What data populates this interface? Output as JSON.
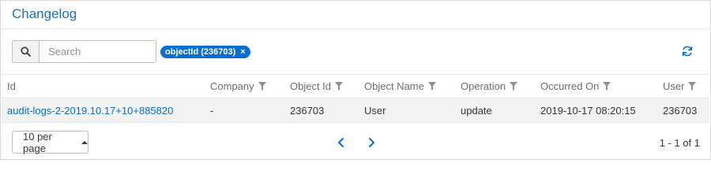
{
  "header": {
    "title": "Changelog"
  },
  "toolbar": {
    "search_placeholder": "Search",
    "search_value": "",
    "filter_chip": "objectId (236703)",
    "chip_close": "×"
  },
  "table": {
    "columns": [
      "Id",
      "Company",
      "Object Id",
      "Object Name",
      "Operation",
      "Occurred On",
      "User"
    ],
    "rows": [
      {
        "id": "audit-logs-2-2019.10.17+10+885820",
        "company": "-",
        "object_id": "236703",
        "object_name": "User",
        "operation": "update",
        "occurred_on": "2019-10-17 08:20:15",
        "user": "236703"
      }
    ]
  },
  "footer": {
    "page_size": "10 per page",
    "range": "1 - 1 of 1"
  },
  "icons": {
    "search": "search-icon",
    "refresh": "refresh-icon",
    "filter": "filter-icon",
    "prev": "chevron-left-icon",
    "next": "chevron-right-icon",
    "caret": "caret-up-icon"
  },
  "colors": {
    "accent": "#0a6ed1",
    "title": "#1d71b8",
    "row_bg": "#f2f2f2"
  }
}
